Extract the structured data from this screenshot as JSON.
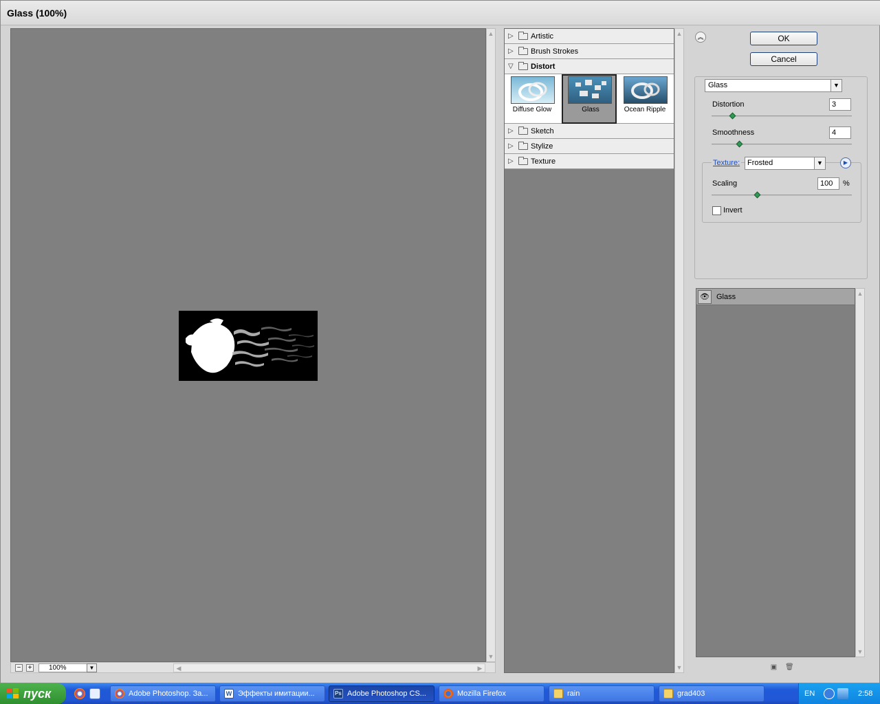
{
  "window": {
    "title": "Glass (100%)"
  },
  "preview": {
    "zoom": "100%",
    "zoom_out": "−",
    "zoom_in": "+"
  },
  "gallery": {
    "categories_top": [
      {
        "label": "Artistic",
        "expanded": false
      },
      {
        "label": "Brush Strokes",
        "expanded": false
      },
      {
        "label": "Distort",
        "expanded": true
      }
    ],
    "distort_filters": [
      {
        "label": "Diffuse Glow",
        "selected": false
      },
      {
        "label": "Glass",
        "selected": true
      },
      {
        "label": "Ocean Ripple",
        "selected": false
      }
    ],
    "categories_bottom": [
      {
        "label": "Sketch"
      },
      {
        "label": "Stylize"
      },
      {
        "label": "Texture"
      }
    ]
  },
  "buttons": {
    "ok": "OK",
    "cancel": "Cancel"
  },
  "settings": {
    "filter": "Glass",
    "distortion": {
      "label": "Distortion",
      "value": "3",
      "fraction": 0.15
    },
    "smoothness": {
      "label": "Smoothness",
      "value": "4",
      "fraction": 0.2
    },
    "texture": {
      "label": "Texture:",
      "value": "Frosted"
    },
    "scaling": {
      "label": "Scaling",
      "value": "100",
      "unit": "%",
      "fraction": 0.33
    },
    "invert": {
      "label": "Invert",
      "checked": false
    }
  },
  "layers": {
    "items": [
      {
        "name": "Glass",
        "visible": true
      }
    ]
  },
  "taskbar": {
    "start": "пуск",
    "tasks": [
      {
        "label": "Adobe Photoshop. За...",
        "active": false,
        "icon": "chrome-icon"
      },
      {
        "label": "Эффекты имитации...",
        "active": false,
        "icon": "word-icon"
      },
      {
        "label": "Adobe Photoshop CS...",
        "active": true,
        "icon": "photoshop-icon"
      },
      {
        "label": "Mozilla Firefox",
        "active": false,
        "icon": "firefox-icon"
      },
      {
        "label": "rain",
        "active": false,
        "icon": "folder-icon"
      },
      {
        "label": "grad403",
        "active": false,
        "icon": "folder-icon"
      }
    ],
    "language": "EN",
    "time": "2:58"
  },
  "colors": {
    "preview_bg": "#808080",
    "taskbar": "#2157d6",
    "start": "#3a9a3a",
    "slider_knob": "#2e9a52"
  }
}
